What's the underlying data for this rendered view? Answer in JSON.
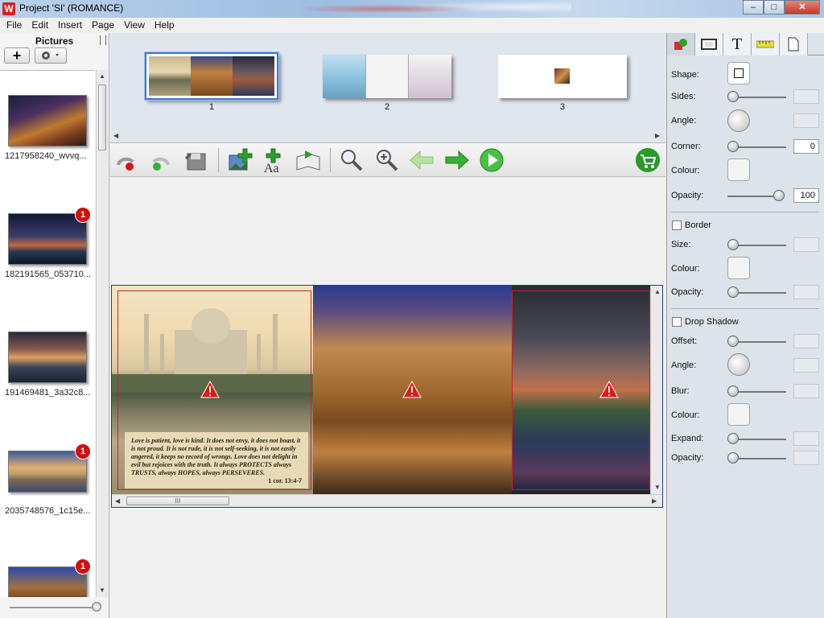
{
  "window": {
    "title": "Project 'SI' (ROMANCE)",
    "icon_letter": "W",
    "minimize": "–",
    "maximize": "□",
    "close": "✕"
  },
  "menu": [
    "File",
    "Edit",
    "Insert",
    "Page",
    "View",
    "Help"
  ],
  "pictures": {
    "heading": "Pictures",
    "add_label": "+",
    "items": [
      {
        "caption": "1217958240_wvvq...",
        "badge": ""
      },
      {
        "caption": "182191565_053710...",
        "badge": "1"
      },
      {
        "caption": "191469481_3a32c8...",
        "badge": ""
      },
      {
        "caption": "2035748576_1c15e...",
        "badge": "1"
      },
      {
        "caption": "",
        "badge": "1"
      }
    ]
  },
  "pages": {
    "numbers": [
      "1",
      "2",
      "3"
    ]
  },
  "toolbar": {
    "icons": [
      "undo-icon",
      "redo-icon",
      "save-icon",
      "add-picture-icon",
      "add-text-icon",
      "add-page-icon",
      "zoom-out-icon",
      "zoom-in-icon",
      "previous-page-icon",
      "next-page-icon",
      "play-icon",
      "order-cart-icon"
    ]
  },
  "spread": {
    "verse": "Love is patient, love is kind. It does not envy, it does not boast, it is not proud. It is not rude, it is not self-seeking, it is not easily angered, it keeps no record of wrongs. Love does not delight in evil but rejoices with the truth. It always PROTECTS always TRUSTS, always HOPES, always PERSEVERES.",
    "verse_ref": "1 cor. 13:4-7",
    "hscroll_grip": "III"
  },
  "properties": {
    "tabs": [
      "shapes-tab-icon",
      "frame-tab-icon",
      "text-tab-icon",
      "ruler-tab-icon",
      "page-tab-icon"
    ],
    "text_tab_glyph": "T",
    "shape_label": "Shape:",
    "sides_label": "Sides:",
    "angle_label": "Angle:",
    "corner_label": "Corner:",
    "corner_value": "0",
    "colour_label": "Colour:",
    "opacity_label": "Opacity:",
    "opacity_value": "100",
    "border_label": "Border",
    "border_size_label": "Size:",
    "border_colour_label": "Colour:",
    "border_opacity_label": "Opacity:",
    "shadow_label": "Drop Shadow",
    "shadow_offset_label": "Offset:",
    "shadow_angle_label": "Angle:",
    "shadow_blur_label": "Blur:",
    "shadow_colour_label": "Colour:",
    "shadow_expand_label": "Expand:",
    "shadow_opacity_label": "Opacity:"
  }
}
